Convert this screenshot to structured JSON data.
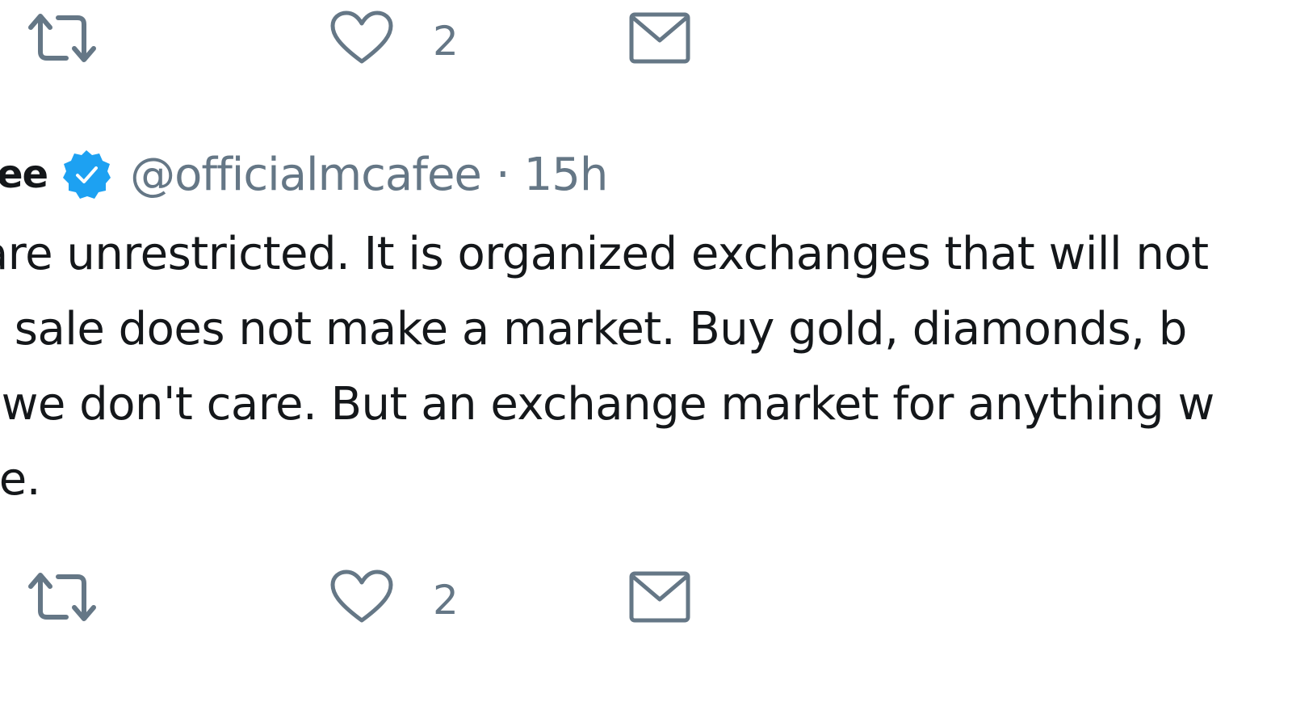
{
  "tweets": [
    {
      "actions": {
        "retweet_icon": "retweet-icon",
        "like_icon": "heart-icon",
        "like_count": "2",
        "dm_icon": "envelope-icon"
      }
    },
    {
      "author": {
        "display_name": "ee",
        "verified": true,
        "handle": "@officialmcafee",
        "separator": "·",
        "time": "15h"
      },
      "text_lines": [
        "s are unrestricted. It is organized exchanges that will not",
        "ite sale does not make a market. Buy gold, diamonds, b",
        ". - we don't care. But an exchange market for anything w",
        "one."
      ],
      "actions": {
        "retweet_icon": "retweet-icon",
        "like_icon": "heart-icon",
        "like_count": "2",
        "dm_icon": "envelope-icon"
      }
    }
  ],
  "colors": {
    "text_primary": "#14171a",
    "text_secondary": "#657786",
    "verified_blue": "#1da1f2",
    "icon_gray": "#657786"
  }
}
